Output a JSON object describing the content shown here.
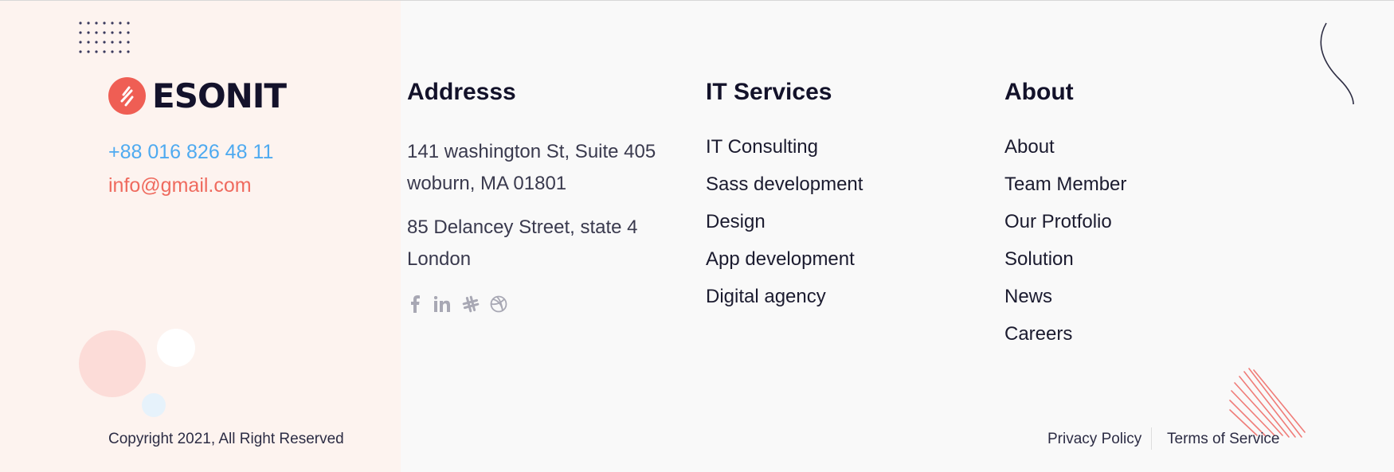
{
  "brand": {
    "name": "ESONIT",
    "accent": "#ef5e54"
  },
  "contact": {
    "phone": "+88 016 826 48 11",
    "email": "info@gmail.com",
    "phone_color": "#4eaaf0",
    "email_color": "#ef6a5e"
  },
  "copyright": "Copyright 2021, All Right Reserved",
  "address": {
    "title": "Addresss",
    "lines": [
      "141 washington St, Suite 405",
      "woburn, MA 01801",
      "85 Delancey Street, state 4",
      "London"
    ],
    "social_icons": [
      "facebook-icon",
      "linkedin-icon",
      "slack-icon",
      "dribbble-icon"
    ]
  },
  "services": {
    "title": "IT Services",
    "items": [
      "IT Consulting",
      "Sass development",
      "Design",
      "App development",
      "Digital agency"
    ]
  },
  "about": {
    "title": "About",
    "items": [
      "About",
      "Team Member",
      "Our Protfolio",
      "Solution",
      "News",
      "Careers"
    ]
  },
  "legal": {
    "privacy": "Privacy Policy",
    "terms": "Terms of Service"
  }
}
